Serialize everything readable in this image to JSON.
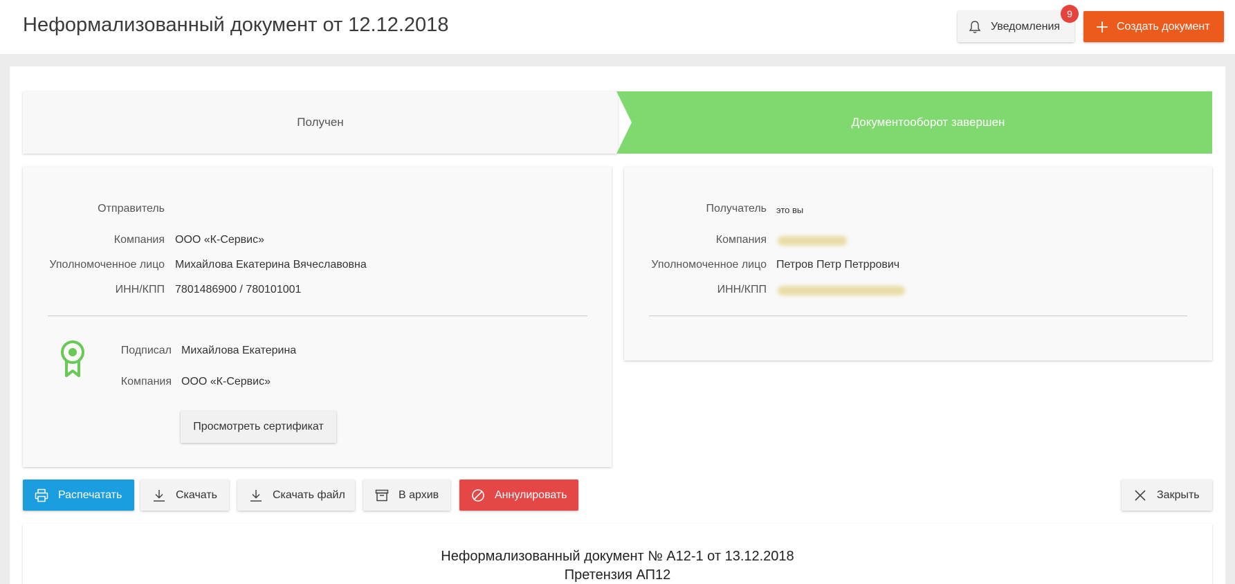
{
  "header": {
    "title": "Неформализованный документ от 12.12.2018",
    "notifications_label": "Уведомления",
    "notifications_count": "9",
    "create_label": "Создать документ"
  },
  "status": {
    "step1": "Получен",
    "step2": "Документооборот завершен",
    "active_color": "#7fd96e"
  },
  "sender": {
    "heading": "Отправитель",
    "company_label": "Компания",
    "company": "ООО «К-Сервис»",
    "person_label": "Уполномоченное лицо",
    "person": "Михайлова Екатерина Вячеславовна",
    "inn_label": "ИНН/КПП",
    "inn": "7801486900 / 780101001",
    "signed_label": "Подписал",
    "signed": "Михайлова Екатерина",
    "sign_company_label": "Компания",
    "sign_company": "ООО «К-Сервис»",
    "cert_button": "Просмотреть сертификат"
  },
  "recipient": {
    "heading": "Получатель",
    "heading_note": "это вы",
    "company_label": "Компания",
    "person_label": "Уполномоченное лицо",
    "person": "Петров Петр Петррович",
    "inn_label": "ИНН/КПП"
  },
  "actions": {
    "print": "Распечатать",
    "download": "Скачать",
    "download_file": "Скачать файл",
    "archive": "В архив",
    "annul": "Аннулировать",
    "close": "Закрыть"
  },
  "document": {
    "title": "Неформализованный документ № А12-1 от 13.12.2018",
    "subtitle": "Претензия АП12"
  },
  "colors": {
    "accent_orange": "#ec5a1c",
    "print_blue": "#1a9ee0",
    "annul_red": "#e54646",
    "badge_red": "#e5433c"
  }
}
